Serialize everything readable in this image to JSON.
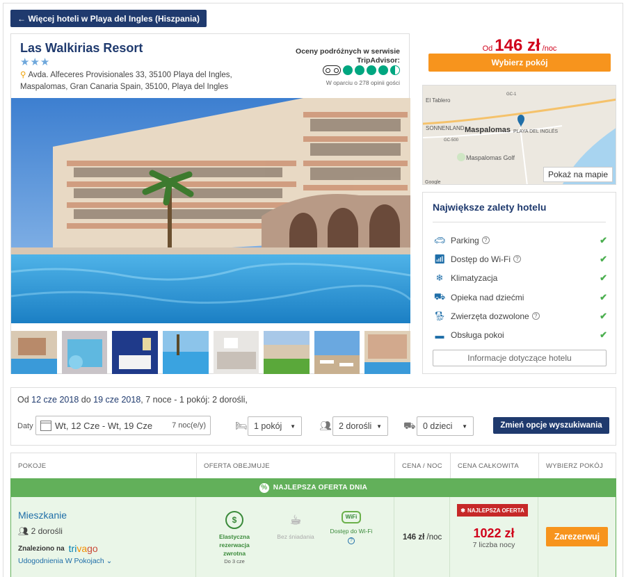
{
  "nav": {
    "back_label": "← Więcej hoteli w Playa del Ingles (Hiszpania)"
  },
  "hotel": {
    "name": "Las Walkirias Resort",
    "stars": "★★★",
    "address_line1": "Avda. Alfeceres Provisionales 33, 35100 Playa del Ingles,",
    "address_line2": "Maspalomas, Gran Canaria Spain, 35100, Playa del Ingles",
    "tripadvisor_title": "Oceny podróżnych w serwisie TripAdvisor:",
    "tripadvisor_rating": 4.5,
    "tripadvisor_note": "W oparciu o 278 opinii gości"
  },
  "price_box": {
    "from": "Od",
    "amount": "146 zł",
    "per_night": "/noc",
    "choose_room": "Wybierz pokój"
  },
  "map": {
    "show_on_map": "Pokaż na mapie",
    "labels": [
      "El Tablero",
      "SONNENLAND",
      "Maspalomas",
      "PLAYA DEL INGLÉS",
      "Maspalomas Golf",
      "GC-1",
      "GC-500",
      "Google"
    ]
  },
  "features": {
    "title": "Największe zalety hotelu",
    "items": [
      {
        "label": "Parking",
        "icon": "car-icon",
        "help": true
      },
      {
        "label": "Dostęp do Wi-Fi",
        "icon": "wifi-icon",
        "help": true
      },
      {
        "label": "Klimatyzacja",
        "icon": "snowflake-icon",
        "help": false
      },
      {
        "label": "Opieka nad dziećmi",
        "icon": "baby-stroller-icon",
        "help": false
      },
      {
        "label": "Zwierzęta dozwolone",
        "icon": "dog-icon",
        "help": true
      },
      {
        "label": "Obsługa pokoi",
        "icon": "room-service-icon",
        "help": false
      }
    ],
    "info_button": "Informacje dotyczące hotelu"
  },
  "search": {
    "dates_prefix": "Od",
    "date_from": "12 cze 2018",
    "dates_mid": "do",
    "date_to": "19 cze 2018",
    "dates_suffix": ", 7 noce - 1 pokój: 2 dorośli,",
    "dates_label": "Daty",
    "date_range": "Wt, 12 Cze - Wt, 19 Cze",
    "nights": "7 noc(e/y)",
    "rooms": "1 pokój",
    "adults": "2 dorośli",
    "children": "0 dzieci",
    "change_button": "Zmień opcje wyszukiwania"
  },
  "table": {
    "headers": [
      "POKOJE",
      "OFERTA OBEJMUJE",
      "CENA / NOC",
      "CENA CAŁKOWITA",
      "WYBIERZ POKÓJ"
    ],
    "best_offer_banner": "NAJLEPSZA OFERTA DNIA",
    "row": {
      "room_name": "Mieszkanie",
      "guests": "2 dorośli",
      "found_on": "Znaleziono na",
      "provider_part1": "tri",
      "provider_part2": "va",
      "provider_part3": "go",
      "amenities_link": "Udogodnienia W Pokojach",
      "offer1_line1": "Elastyczna",
      "offer1_line2": "rezerwacja",
      "offer1_line3": "zwrotna",
      "offer1_sub": "Do 3 cze",
      "offer2": "Bez śniadania",
      "offer3": "Dostęp do Wi-Fi",
      "price_per_night": "146  zł",
      "per_night": "/noc",
      "best_badge": "NAJLEPSZA OFERTA",
      "total": "1022 zł",
      "total_nights": "7 liczba nocy",
      "book_button": "Zarezerwuj"
    }
  },
  "colors": {
    "navy": "#1f3a6e",
    "orange": "#f7941d",
    "price_red": "#d0021b",
    "green": "#62b05a",
    "tripadvisor": "#00a680"
  }
}
